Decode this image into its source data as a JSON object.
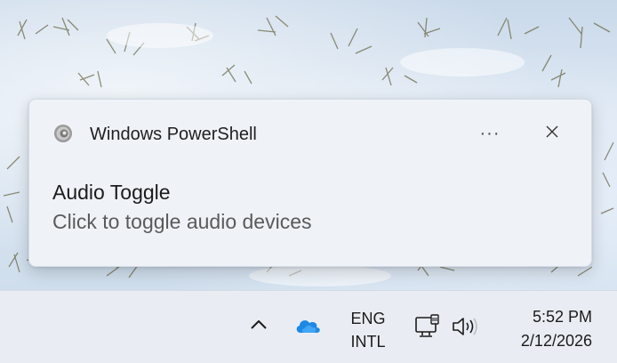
{
  "notification": {
    "app_name": "Windows PowerShell",
    "app_icon": "speaker-icon",
    "more_label": "···",
    "close_icon": "close-icon",
    "title": "Audio Toggle",
    "body": "Click to toggle audio devices"
  },
  "taskbar": {
    "overflow_icon": "chevron-up-icon",
    "cloud_icon": "onedrive-cloud-icon",
    "language_line1": "ENG",
    "language_line2": "INTL",
    "network_icon": "ethernet-icon",
    "volume_icon": "speaker-volume-icon",
    "time": "5:52 PM",
    "date": "2/12/2026"
  },
  "colors": {
    "accent": "#0f6cbd",
    "toast_bg": "#eff3f8",
    "taskbar_bg": "#e9edf3"
  }
}
